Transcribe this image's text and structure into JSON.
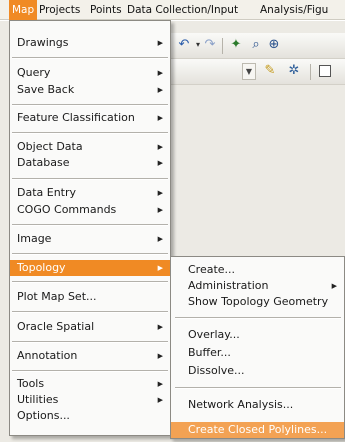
{
  "menubar": {
    "items": [
      {
        "label": "Map"
      },
      {
        "label": "Projects"
      },
      {
        "label": "Points"
      },
      {
        "label": "Data Collection/Input"
      },
      {
        "label": "Analysis/Figu"
      }
    ]
  },
  "menu": {
    "items": [
      {
        "label": "Drawings"
      },
      {
        "label": "Query"
      },
      {
        "label": "Save Back"
      },
      {
        "label": "Feature Classification"
      },
      {
        "label": "Object Data"
      },
      {
        "label": "Database"
      },
      {
        "label": "Data Entry"
      },
      {
        "label": "COGO Commands"
      },
      {
        "label": "Image"
      },
      {
        "label": "Topology"
      },
      {
        "label": "Plot Map Set..."
      },
      {
        "label": "Oracle Spatial"
      },
      {
        "label": "Annotation"
      },
      {
        "label": "Tools"
      },
      {
        "label": "Utilities"
      },
      {
        "label": "Options..."
      }
    ]
  },
  "submenu": {
    "items": [
      {
        "label": "Create..."
      },
      {
        "label": "Administration"
      },
      {
        "label": "Show Topology Geometry"
      },
      {
        "label": "Overlay..."
      },
      {
        "label": "Buffer..."
      },
      {
        "label": "Dissolve..."
      },
      {
        "label": "Network Analysis..."
      },
      {
        "label": "Create Closed Polylines..."
      }
    ]
  },
  "colors": {
    "highlight": "#f08a24"
  },
  "icons": [
    "undo-icon",
    "redo-icon",
    "layer-icon",
    "zoom-icon",
    "zoom-window-icon",
    "dropdown-icon",
    "map-icon",
    "settings-icon",
    "checkbox-icon",
    "submenu-arrow-icon"
  ]
}
